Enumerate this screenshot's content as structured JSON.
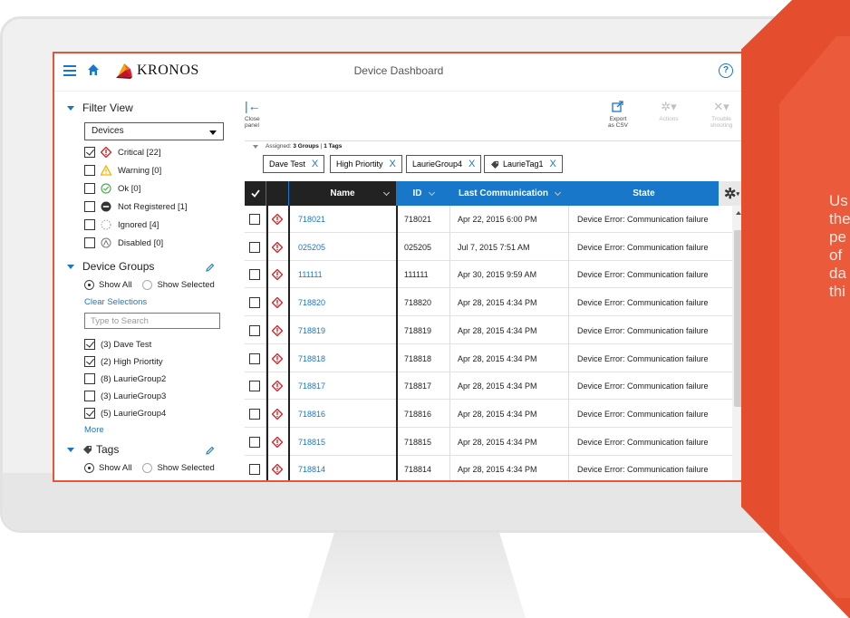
{
  "header": {
    "logo_text": "KRONOS",
    "title": "Device Dashboard",
    "help_symbol": "?"
  },
  "banner": {
    "text_lines": [
      "Us",
      "the",
      "pe",
      "of",
      "da",
      "thi"
    ],
    "color": "#e44d2e"
  },
  "sidebar": {
    "filter_title": "Filter View",
    "select_value": "Devices",
    "statuses": [
      {
        "label": "Critical [22]",
        "checked": true,
        "icon": "critical-icon"
      },
      {
        "label": "Warning [0]",
        "checked": false,
        "icon": "warning-icon"
      },
      {
        "label": "Ok [0]",
        "checked": false,
        "icon": "ok-icon"
      },
      {
        "label": "Not Registered [1]",
        "checked": false,
        "icon": "not-registered-icon"
      },
      {
        "label": "Ignored [4]",
        "checked": false,
        "icon": "ignored-icon"
      },
      {
        "label": "Disabled [0]",
        "checked": false,
        "icon": "disabled-icon"
      }
    ],
    "groups_title": "Device Groups",
    "show_all": "Show All",
    "show_selected": "Show Selected",
    "clear_selections": "Clear Selections",
    "search_placeholder": "Type to Search",
    "groups": [
      {
        "label": "(3) Dave Test",
        "checked": true
      },
      {
        "label": "(2) High Priortity",
        "checked": true
      },
      {
        "label": "(8) LaurieGroup2",
        "checked": false
      },
      {
        "label": "(3) LaurieGroup3",
        "checked": false
      },
      {
        "label": "(5) LaurieGroup4",
        "checked": true
      }
    ],
    "more": "More",
    "tags_title": "Tags",
    "tags_show_all": "Show All",
    "tags_show_selected": "Show Selected"
  },
  "toolbar": {
    "close_panel_line1": "Close",
    "close_panel_line2": "panel",
    "export_line1": "Export",
    "export_line2": "as CSV",
    "actions": "Actions",
    "trouble_line1": "Trouble",
    "trouble_line2": "shooting"
  },
  "assigned": {
    "prefix": "Assigned:",
    "groups": "3 Groups",
    "separator": "|",
    "tags": "1 Tags"
  },
  "chips": [
    "Dave Test",
    "High Priortity",
    "LaurieGroup4",
    "LaurieTag1"
  ],
  "chip_close": "X",
  "table": {
    "columns": [
      "Name",
      "ID",
      "Last Communication",
      "State"
    ],
    "rows": [
      {
        "name": "718021",
        "id": "718021",
        "last": "Apr 22, 2015 6:00 PM",
        "state": "Device Error: Communication failure"
      },
      {
        "name": "025205",
        "id": "025205",
        "last": "Jul 7, 2015 7:51 AM",
        "state": "Device Error: Communication failure"
      },
      {
        "name": "111111",
        "id": "111111",
        "last": "Apr 30, 2015 9:59 AM",
        "state": "Device Error: Communication failure"
      },
      {
        "name": "718820",
        "id": "718820",
        "last": "Apr 28, 2015 4:34 PM",
        "state": "Device Error: Communication failure"
      },
      {
        "name": "718819",
        "id": "718819",
        "last": "Apr 28, 2015 4:34 PM",
        "state": "Device Error: Communication failure"
      },
      {
        "name": "718818",
        "id": "718818",
        "last": "Apr 28, 2015 4:34 PM",
        "state": "Device Error: Communication failure"
      },
      {
        "name": "718817",
        "id": "718817",
        "last": "Apr 28, 2015 4:34 PM",
        "state": "Device Error: Communication failure"
      },
      {
        "name": "718816",
        "id": "718816",
        "last": "Apr 28, 2015 4:34 PM",
        "state": "Device Error: Communication failure"
      },
      {
        "name": "718815",
        "id": "718815",
        "last": "Apr 28, 2015 4:34 PM",
        "state": "Device Error: Communication failure"
      },
      {
        "name": "718814",
        "id": "718814",
        "last": "Apr 28, 2015 4:34 PM",
        "state": "Device Error: Communication failure"
      }
    ]
  },
  "colors": {
    "accent": "#1877c8",
    "critical": "#d7262c",
    "warning": "#f2b600",
    "ok": "#4caf50",
    "frame": "#e8543a"
  }
}
